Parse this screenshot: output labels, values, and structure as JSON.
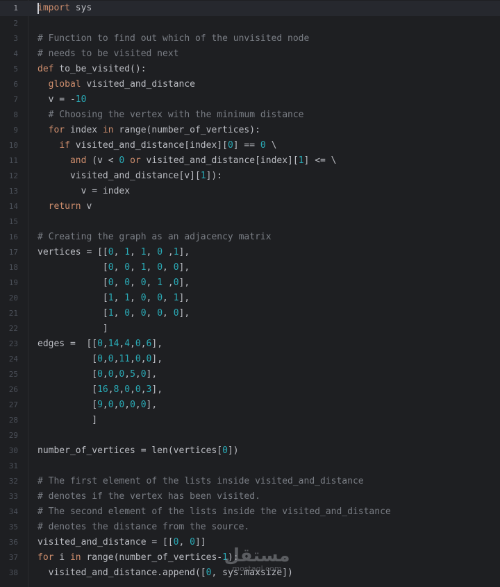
{
  "editor": {
    "current_line": 1,
    "lines": [
      {
        "n": "1",
        "tokens": [
          {
            "t": "import",
            "c": "kw"
          },
          {
            "t": " sys",
            "c": "tx"
          }
        ]
      },
      {
        "n": "2",
        "tokens": []
      },
      {
        "n": "3",
        "tokens": [
          {
            "t": "# Function to find out which of the unvisited node",
            "c": "cm"
          }
        ]
      },
      {
        "n": "4",
        "tokens": [
          {
            "t": "# needs to be visited next",
            "c": "cm"
          }
        ]
      },
      {
        "n": "5",
        "tokens": [
          {
            "t": "def",
            "c": "kw"
          },
          {
            "t": " to_be_visited():",
            "c": "tx"
          }
        ]
      },
      {
        "n": "6",
        "tokens": [
          {
            "t": "  ",
            "c": "tx"
          },
          {
            "t": "global",
            "c": "kw"
          },
          {
            "t": " visited_and_distance",
            "c": "tx"
          }
        ]
      },
      {
        "n": "7",
        "tokens": [
          {
            "t": "  v = -",
            "c": "tx"
          },
          {
            "t": "10",
            "c": "num"
          }
        ]
      },
      {
        "n": "8",
        "tokens": [
          {
            "t": "  # Choosing the vertex with the minimum distance",
            "c": "cm"
          }
        ]
      },
      {
        "n": "9",
        "tokens": [
          {
            "t": "  ",
            "c": "tx"
          },
          {
            "t": "for",
            "c": "kw"
          },
          {
            "t": " index ",
            "c": "tx"
          },
          {
            "t": "in",
            "c": "kw"
          },
          {
            "t": " range(number_of_vertices):",
            "c": "tx"
          }
        ]
      },
      {
        "n": "10",
        "tokens": [
          {
            "t": "    ",
            "c": "tx"
          },
          {
            "t": "if",
            "c": "kw"
          },
          {
            "t": " visited_and_distance[index][",
            "c": "tx"
          },
          {
            "t": "0",
            "c": "num"
          },
          {
            "t": "] == ",
            "c": "tx"
          },
          {
            "t": "0",
            "c": "num"
          },
          {
            "t": " \\",
            "c": "tx"
          }
        ]
      },
      {
        "n": "11",
        "tokens": [
          {
            "t": "      ",
            "c": "tx"
          },
          {
            "t": "and",
            "c": "kw"
          },
          {
            "t": " (v < ",
            "c": "tx"
          },
          {
            "t": "0",
            "c": "num"
          },
          {
            "t": " ",
            "c": "tx"
          },
          {
            "t": "or",
            "c": "kw"
          },
          {
            "t": " visited_and_distance[index][",
            "c": "tx"
          },
          {
            "t": "1",
            "c": "num"
          },
          {
            "t": "] <= \\",
            "c": "tx"
          }
        ]
      },
      {
        "n": "12",
        "tokens": [
          {
            "t": "      visited_and_distance[v][",
            "c": "tx"
          },
          {
            "t": "1",
            "c": "num"
          },
          {
            "t": "]):",
            "c": "tx"
          }
        ]
      },
      {
        "n": "13",
        "tokens": [
          {
            "t": "        v = index",
            "c": "tx"
          }
        ]
      },
      {
        "n": "14",
        "tokens": [
          {
            "t": "  ",
            "c": "tx"
          },
          {
            "t": "return",
            "c": "kw"
          },
          {
            "t": " v",
            "c": "tx"
          }
        ]
      },
      {
        "n": "15",
        "tokens": []
      },
      {
        "n": "16",
        "tokens": [
          {
            "t": "# Creating the graph as an adjacency matrix",
            "c": "cm"
          }
        ]
      },
      {
        "n": "17",
        "tokens": [
          {
            "t": "vertices = [[",
            "c": "tx"
          },
          {
            "t": "0",
            "c": "num"
          },
          {
            "t": ", ",
            "c": "tx"
          },
          {
            "t": "1",
            "c": "num"
          },
          {
            "t": ", ",
            "c": "tx"
          },
          {
            "t": "1",
            "c": "num"
          },
          {
            "t": ", ",
            "c": "tx"
          },
          {
            "t": "0",
            "c": "num"
          },
          {
            "t": " ,",
            "c": "tx"
          },
          {
            "t": "1",
            "c": "num"
          },
          {
            "t": "],",
            "c": "tx"
          }
        ]
      },
      {
        "n": "18",
        "tokens": [
          {
            "t": "            [",
            "c": "tx"
          },
          {
            "t": "0",
            "c": "num"
          },
          {
            "t": ", ",
            "c": "tx"
          },
          {
            "t": "0",
            "c": "num"
          },
          {
            "t": ", ",
            "c": "tx"
          },
          {
            "t": "1",
            "c": "num"
          },
          {
            "t": ", ",
            "c": "tx"
          },
          {
            "t": "0",
            "c": "num"
          },
          {
            "t": ", ",
            "c": "tx"
          },
          {
            "t": "0",
            "c": "num"
          },
          {
            "t": "],",
            "c": "tx"
          }
        ]
      },
      {
        "n": "19",
        "tokens": [
          {
            "t": "            [",
            "c": "tx"
          },
          {
            "t": "0",
            "c": "num"
          },
          {
            "t": ", ",
            "c": "tx"
          },
          {
            "t": "0",
            "c": "num"
          },
          {
            "t": ", ",
            "c": "tx"
          },
          {
            "t": "0",
            "c": "num"
          },
          {
            "t": ", ",
            "c": "tx"
          },
          {
            "t": "1",
            "c": "num"
          },
          {
            "t": " ,",
            "c": "tx"
          },
          {
            "t": "0",
            "c": "num"
          },
          {
            "t": "],",
            "c": "tx"
          }
        ]
      },
      {
        "n": "20",
        "tokens": [
          {
            "t": "            [",
            "c": "tx"
          },
          {
            "t": "1",
            "c": "num"
          },
          {
            "t": ", ",
            "c": "tx"
          },
          {
            "t": "1",
            "c": "num"
          },
          {
            "t": ", ",
            "c": "tx"
          },
          {
            "t": "0",
            "c": "num"
          },
          {
            "t": ", ",
            "c": "tx"
          },
          {
            "t": "0",
            "c": "num"
          },
          {
            "t": ", ",
            "c": "tx"
          },
          {
            "t": "1",
            "c": "num"
          },
          {
            "t": "],",
            "c": "tx"
          }
        ]
      },
      {
        "n": "21",
        "tokens": [
          {
            "t": "            [",
            "c": "tx"
          },
          {
            "t": "1",
            "c": "num"
          },
          {
            "t": ", ",
            "c": "tx"
          },
          {
            "t": "0",
            "c": "num"
          },
          {
            "t": ", ",
            "c": "tx"
          },
          {
            "t": "0",
            "c": "num"
          },
          {
            "t": ", ",
            "c": "tx"
          },
          {
            "t": "0",
            "c": "num"
          },
          {
            "t": ", ",
            "c": "tx"
          },
          {
            "t": "0",
            "c": "num"
          },
          {
            "t": "],",
            "c": "tx"
          }
        ]
      },
      {
        "n": "22",
        "tokens": [
          {
            "t": "            ]",
            "c": "tx"
          }
        ]
      },
      {
        "n": "23",
        "tokens": [
          {
            "t": "edges =  [[",
            "c": "tx"
          },
          {
            "t": "0",
            "c": "num"
          },
          {
            "t": ",",
            "c": "tx"
          },
          {
            "t": "14",
            "c": "num"
          },
          {
            "t": ",",
            "c": "tx"
          },
          {
            "t": "4",
            "c": "num"
          },
          {
            "t": ",",
            "c": "tx"
          },
          {
            "t": "0",
            "c": "num"
          },
          {
            "t": ",",
            "c": "tx"
          },
          {
            "t": "6",
            "c": "num"
          },
          {
            "t": "],",
            "c": "tx"
          }
        ]
      },
      {
        "n": "24",
        "tokens": [
          {
            "t": "          [",
            "c": "tx"
          },
          {
            "t": "0",
            "c": "num"
          },
          {
            "t": ",",
            "c": "tx"
          },
          {
            "t": "0",
            "c": "num"
          },
          {
            "t": ",",
            "c": "tx"
          },
          {
            "t": "11",
            "c": "num"
          },
          {
            "t": ",",
            "c": "tx"
          },
          {
            "t": "0",
            "c": "num"
          },
          {
            "t": ",",
            "c": "tx"
          },
          {
            "t": "0",
            "c": "num"
          },
          {
            "t": "],",
            "c": "tx"
          }
        ]
      },
      {
        "n": "25",
        "tokens": [
          {
            "t": "          [",
            "c": "tx"
          },
          {
            "t": "0",
            "c": "num"
          },
          {
            "t": ",",
            "c": "tx"
          },
          {
            "t": "0",
            "c": "num"
          },
          {
            "t": ",",
            "c": "tx"
          },
          {
            "t": "0",
            "c": "num"
          },
          {
            "t": ",",
            "c": "tx"
          },
          {
            "t": "5",
            "c": "num"
          },
          {
            "t": ",",
            "c": "tx"
          },
          {
            "t": "0",
            "c": "num"
          },
          {
            "t": "],",
            "c": "tx"
          }
        ]
      },
      {
        "n": "26",
        "tokens": [
          {
            "t": "          [",
            "c": "tx"
          },
          {
            "t": "16",
            "c": "num"
          },
          {
            "t": ",",
            "c": "tx"
          },
          {
            "t": "8",
            "c": "num"
          },
          {
            "t": ",",
            "c": "tx"
          },
          {
            "t": "0",
            "c": "num"
          },
          {
            "t": ",",
            "c": "tx"
          },
          {
            "t": "0",
            "c": "num"
          },
          {
            "t": ",",
            "c": "tx"
          },
          {
            "t": "3",
            "c": "num"
          },
          {
            "t": "],",
            "c": "tx"
          }
        ]
      },
      {
        "n": "27",
        "tokens": [
          {
            "t": "          [",
            "c": "tx"
          },
          {
            "t": "9",
            "c": "num"
          },
          {
            "t": ",",
            "c": "tx"
          },
          {
            "t": "0",
            "c": "num"
          },
          {
            "t": ",",
            "c": "tx"
          },
          {
            "t": "0",
            "c": "num"
          },
          {
            "t": ",",
            "c": "tx"
          },
          {
            "t": "0",
            "c": "num"
          },
          {
            "t": ",",
            "c": "tx"
          },
          {
            "t": "0",
            "c": "num"
          },
          {
            "t": "],",
            "c": "tx"
          }
        ]
      },
      {
        "n": "28",
        "tokens": [
          {
            "t": "          ]",
            "c": "tx"
          }
        ]
      },
      {
        "n": "29",
        "tokens": []
      },
      {
        "n": "30",
        "tokens": [
          {
            "t": "number_of_vertices = len(vertices[",
            "c": "tx"
          },
          {
            "t": "0",
            "c": "num"
          },
          {
            "t": "])",
            "c": "tx"
          }
        ]
      },
      {
        "n": "31",
        "tokens": []
      },
      {
        "n": "32",
        "tokens": [
          {
            "t": "# The first element of the lists inside visited_and_distance",
            "c": "cm"
          }
        ]
      },
      {
        "n": "33",
        "tokens": [
          {
            "t": "# denotes if the vertex has been visited.",
            "c": "cm"
          }
        ]
      },
      {
        "n": "34",
        "tokens": [
          {
            "t": "# The second element of the lists inside the visited_and_distance",
            "c": "cm"
          }
        ]
      },
      {
        "n": "35",
        "tokens": [
          {
            "t": "# denotes the distance from the source.",
            "c": "cm"
          }
        ]
      },
      {
        "n": "36",
        "tokens": [
          {
            "t": "visited_and_distance = [[",
            "c": "tx"
          },
          {
            "t": "0",
            "c": "num"
          },
          {
            "t": ", ",
            "c": "tx"
          },
          {
            "t": "0",
            "c": "num"
          },
          {
            "t": "]]",
            "c": "tx"
          }
        ]
      },
      {
        "n": "37",
        "tokens": [
          {
            "t": "for",
            "c": "kw"
          },
          {
            "t": " i ",
            "c": "tx"
          },
          {
            "t": "in",
            "c": "kw"
          },
          {
            "t": " range(number_of_vertices-",
            "c": "tx"
          },
          {
            "t": "1",
            "c": "num"
          },
          {
            "t": "):",
            "c": "tx"
          }
        ]
      },
      {
        "n": "38",
        "tokens": [
          {
            "t": "  visited_and_distance.append([",
            "c": "tx"
          },
          {
            "t": "0",
            "c": "num"
          },
          {
            "t": ", sys.maxsize])",
            "c": "tx"
          }
        ]
      }
    ]
  },
  "watermark": {
    "main": "مستقل",
    "sub": "mostaql.com"
  },
  "colors": {
    "background": "#1e1f22",
    "keyword": "#cf8e6d",
    "number": "#2aacb8",
    "comment": "#7a7e85",
    "text": "#bcbec4",
    "line_number": "#4b5059"
  }
}
